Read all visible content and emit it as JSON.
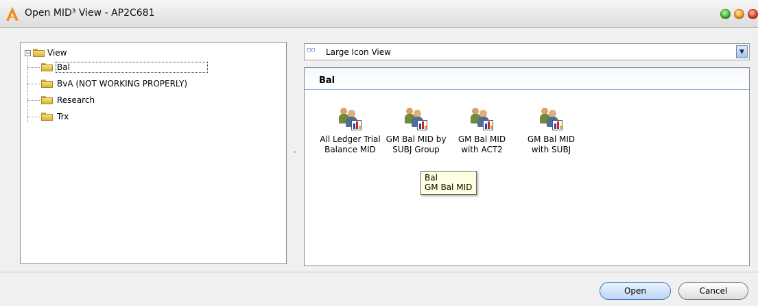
{
  "window": {
    "title": "Open MID³ View - AP2C681"
  },
  "tree": {
    "root_label": "View",
    "items": [
      {
        "label": "Bal",
        "selected": true
      },
      {
        "label": "BvA (NOT WORKING PROPERLY)",
        "selected": false
      },
      {
        "label": "Research",
        "selected": false
      },
      {
        "label": "Trx",
        "selected": false
      }
    ]
  },
  "view_selector": {
    "icon": "large-icon-view-icon",
    "value": "Large Icon View"
  },
  "content": {
    "group_label": "Bal",
    "items": [
      {
        "line1": "All Ledger Trial",
        "line2": "Balance MID"
      },
      {
        "line1": "GM Bal MID by",
        "line2": "SUBJ Group"
      },
      {
        "line1": "GM Bal MID",
        "line2": "with ACT2"
      },
      {
        "line1": "GM Bal MID",
        "line2": "with SUBJ"
      }
    ]
  },
  "tooltip": {
    "line1": "Bal",
    "line2": "GM Bal MID"
  },
  "buttons": {
    "open": "Open",
    "cancel": "Cancel"
  },
  "colors": {
    "accent": "#4a7ab4",
    "header_rule": "#8fb3dd",
    "tooltip_bg": "#ffffe1"
  }
}
